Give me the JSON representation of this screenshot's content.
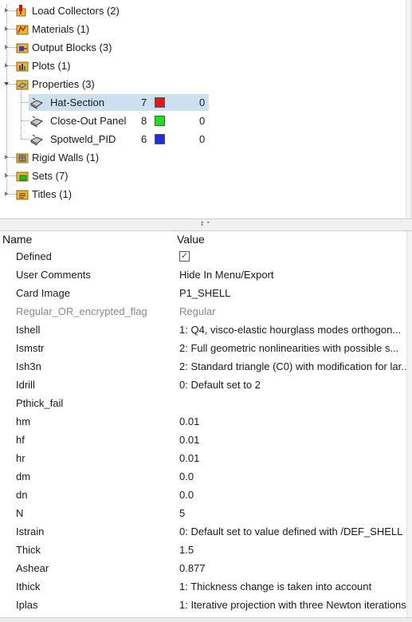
{
  "tree": {
    "items": [
      {
        "label": "Load Collectors (2)",
        "icon": "load-collector-icon"
      },
      {
        "label": "Materials (1)",
        "icon": "material-icon"
      },
      {
        "label": "Output Blocks (3)",
        "icon": "output-block-icon"
      },
      {
        "label": "Plots (1)",
        "icon": "plot-icon"
      },
      {
        "label": "Properties (3)",
        "icon": "properties-icon"
      },
      {
        "label": "Rigid Walls (1)",
        "icon": "rigid-wall-icon"
      },
      {
        "label": "Sets (7)",
        "icon": "set-icon"
      },
      {
        "label": "Titles (1)",
        "icon": "title-icon"
      }
    ],
    "properties": [
      {
        "label": "Hat-Section",
        "id": "7",
        "color": "#e01818",
        "value": "0",
        "selected": true
      },
      {
        "label": "Close-Out Panel",
        "id": "8",
        "color": "#22dd22",
        "value": "0",
        "selected": false
      },
      {
        "label": "Spotweld_PID",
        "id": "6",
        "color": "#1a2ee6",
        "value": "0",
        "selected": false
      }
    ]
  },
  "grid": {
    "header_name": "Name",
    "header_value": "Value",
    "defined_label": "Defined",
    "defined_checked": true,
    "rows": [
      {
        "name": "User Comments",
        "value": "Hide In Menu/Export"
      },
      {
        "name": "Card Image",
        "value": "P1_SHELL"
      },
      {
        "name": "Regular_OR_encrypted_flag",
        "value": "Regular"
      },
      {
        "name": "Ishell",
        "value": "1: Q4, visco-elastic hourglass modes orthogon..."
      },
      {
        "name": "Ismstr",
        "value": "2: Full geometric nonlinearities with possible s..."
      },
      {
        "name": "Ish3n",
        "value": "2: Standard triangle (C0) with modification for lar..."
      },
      {
        "name": "Idrill",
        "value": "0: Default set to 2"
      },
      {
        "name": "Pthick_fail",
        "value": ""
      },
      {
        "name": "hm",
        "value": "0.01"
      },
      {
        "name": "hf",
        "value": "0.01"
      },
      {
        "name": "hr",
        "value": "0.01"
      },
      {
        "name": "dm",
        "value": "0.0"
      },
      {
        "name": "dn",
        "value": "0.0"
      },
      {
        "name": "N",
        "value": "5"
      },
      {
        "name": "Istrain",
        "value": "0: Default set to value defined with /DEF_SHELL"
      },
      {
        "name": "Thick",
        "value": "1.5"
      },
      {
        "name": "Ashear",
        "value": "0.877"
      },
      {
        "name": "Ithick",
        "value": "1: Thickness change is taken into account"
      },
      {
        "name": "Iplas",
        "value": "1: Iterative projection with three Newton iterations"
      }
    ]
  }
}
